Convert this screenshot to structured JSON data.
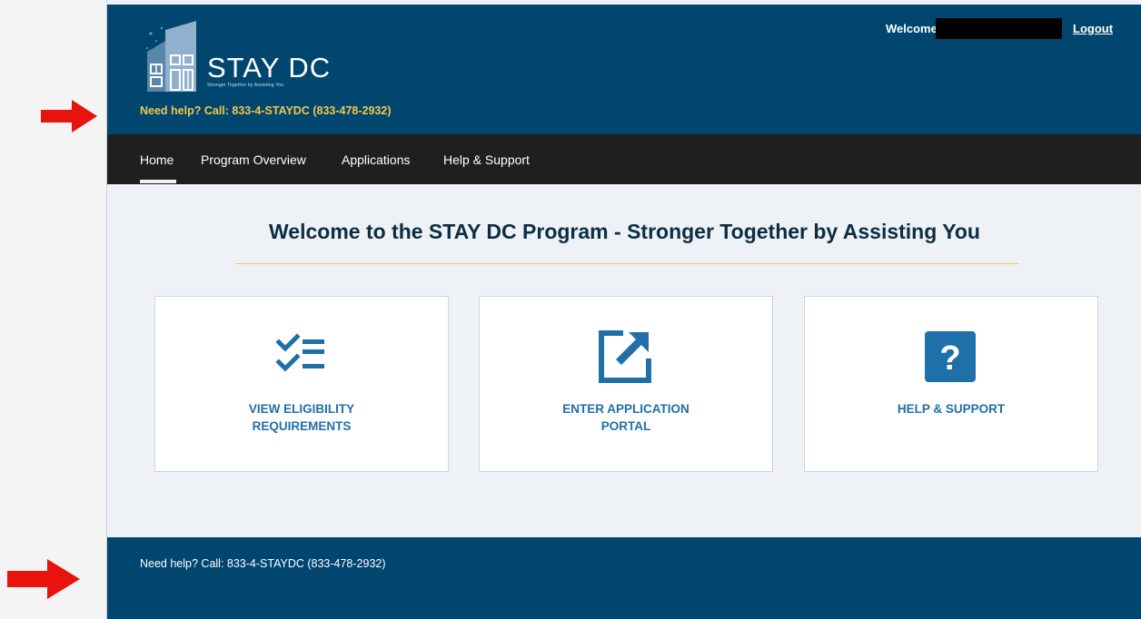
{
  "header": {
    "logo_title": "STAY DC",
    "logo_tagline": "Stronger Together by Assisting You",
    "help_text": "Need help? Call: 833-4-STAYDC (833-478-2932)",
    "welcome_label": "Welcome,",
    "logout_label": "Logout"
  },
  "nav": {
    "items": [
      {
        "label": "Home",
        "active": true
      },
      {
        "label": "Program Overview"
      },
      {
        "label": "Applications"
      },
      {
        "label": "Help & Support"
      }
    ]
  },
  "main": {
    "title": "Welcome to the STAY DC Program - Stronger Together by Assisting You",
    "cards": [
      {
        "label": "VIEW ELIGIBILITY REQUIREMENTS",
        "icon": "checklist-icon"
      },
      {
        "label": "ENTER APPLICATION PORTAL",
        "icon": "external-link-icon"
      },
      {
        "label": "HELP & SUPPORT",
        "icon": "question-icon"
      }
    ]
  },
  "footer": {
    "help_text": "Need help? Call: 833-4-STAYDC (833-478-2932)"
  },
  "colors": {
    "header_bg": "#00466e",
    "nav_bg": "#1f1f1f",
    "accent_yellow": "#f3c64b",
    "card_label": "#1f6fa8",
    "arrow": "#e8130c"
  }
}
